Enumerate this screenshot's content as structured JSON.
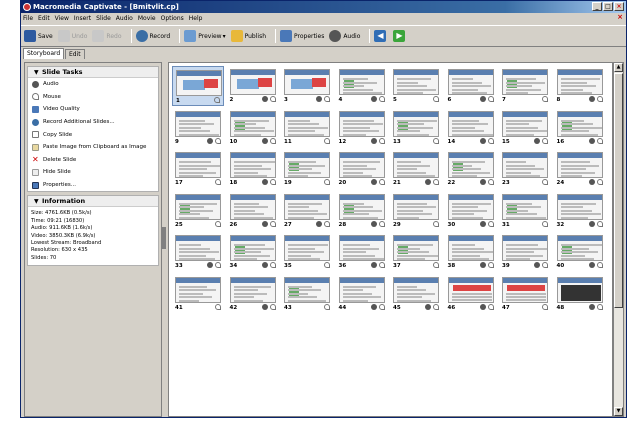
{
  "window": {
    "title": "Macromedia Captivate - [Bmitvlit.cp]",
    "controls": [
      "_",
      "□",
      "×"
    ]
  },
  "menu": [
    "File",
    "Edit",
    "View",
    "Insert",
    "Slide",
    "Audio",
    "Movie",
    "Options",
    "Help"
  ],
  "toolbar": [
    {
      "label": "Save",
      "icon": "save-icon",
      "enabled": true
    },
    {
      "label": "Undo",
      "icon": "undo-icon",
      "enabled": false
    },
    {
      "label": "Redo",
      "icon": "redo-icon",
      "enabled": false
    },
    {
      "label": "Record",
      "icon": "record-icon",
      "enabled": true
    },
    {
      "label": "Preview",
      "icon": "preview-icon",
      "enabled": true
    },
    {
      "label": "Publish",
      "icon": "publish-icon",
      "enabled": true
    },
    {
      "label": "Properties",
      "icon": "properties-icon",
      "enabled": true
    },
    {
      "label": "Audio",
      "icon": "audio-icon",
      "enabled": true
    }
  ],
  "tabs": [
    "Storyboard",
    "Edit"
  ],
  "slide_tasks": {
    "title": "Slide Tasks",
    "items": [
      "Audio",
      "Mouse",
      "Video Quality",
      "Record Additional Slides...",
      "Copy Slide",
      "Paste Image from Clipboard as Image",
      "Delete Slide",
      "Hide Slide",
      "Properties..."
    ]
  },
  "information": {
    "title": "Information",
    "lines": [
      "Size: 4761.6KB (0.5k/s)",
      "Time: 09:21 (16830)",
      "Audio: 911.6KB (1.6k/s)",
      "Video: 3850.3KB (6.9k/s)",
      "Lowest Stream: Broadband",
      "Resolution: 630 x 435",
      "Slides: 70"
    ]
  },
  "slides": {
    "selected": 1,
    "visible_numbers": [
      1,
      2,
      3,
      4,
      5,
      6,
      7,
      8,
      9,
      10,
      11,
      12,
      13,
      14,
      15,
      16,
      17,
      18,
      19,
      20,
      21,
      22,
      23,
      24,
      25,
      26,
      27,
      28,
      29,
      30,
      31,
      32,
      33,
      34,
      35,
      36,
      37,
      38,
      39,
      40,
      41,
      42,
      43,
      44,
      45,
      46,
      47,
      48
    ]
  },
  "colors": {
    "titlebar": "#0a246a",
    "selection": "#c8daf0",
    "delete": "#cc0000"
  }
}
